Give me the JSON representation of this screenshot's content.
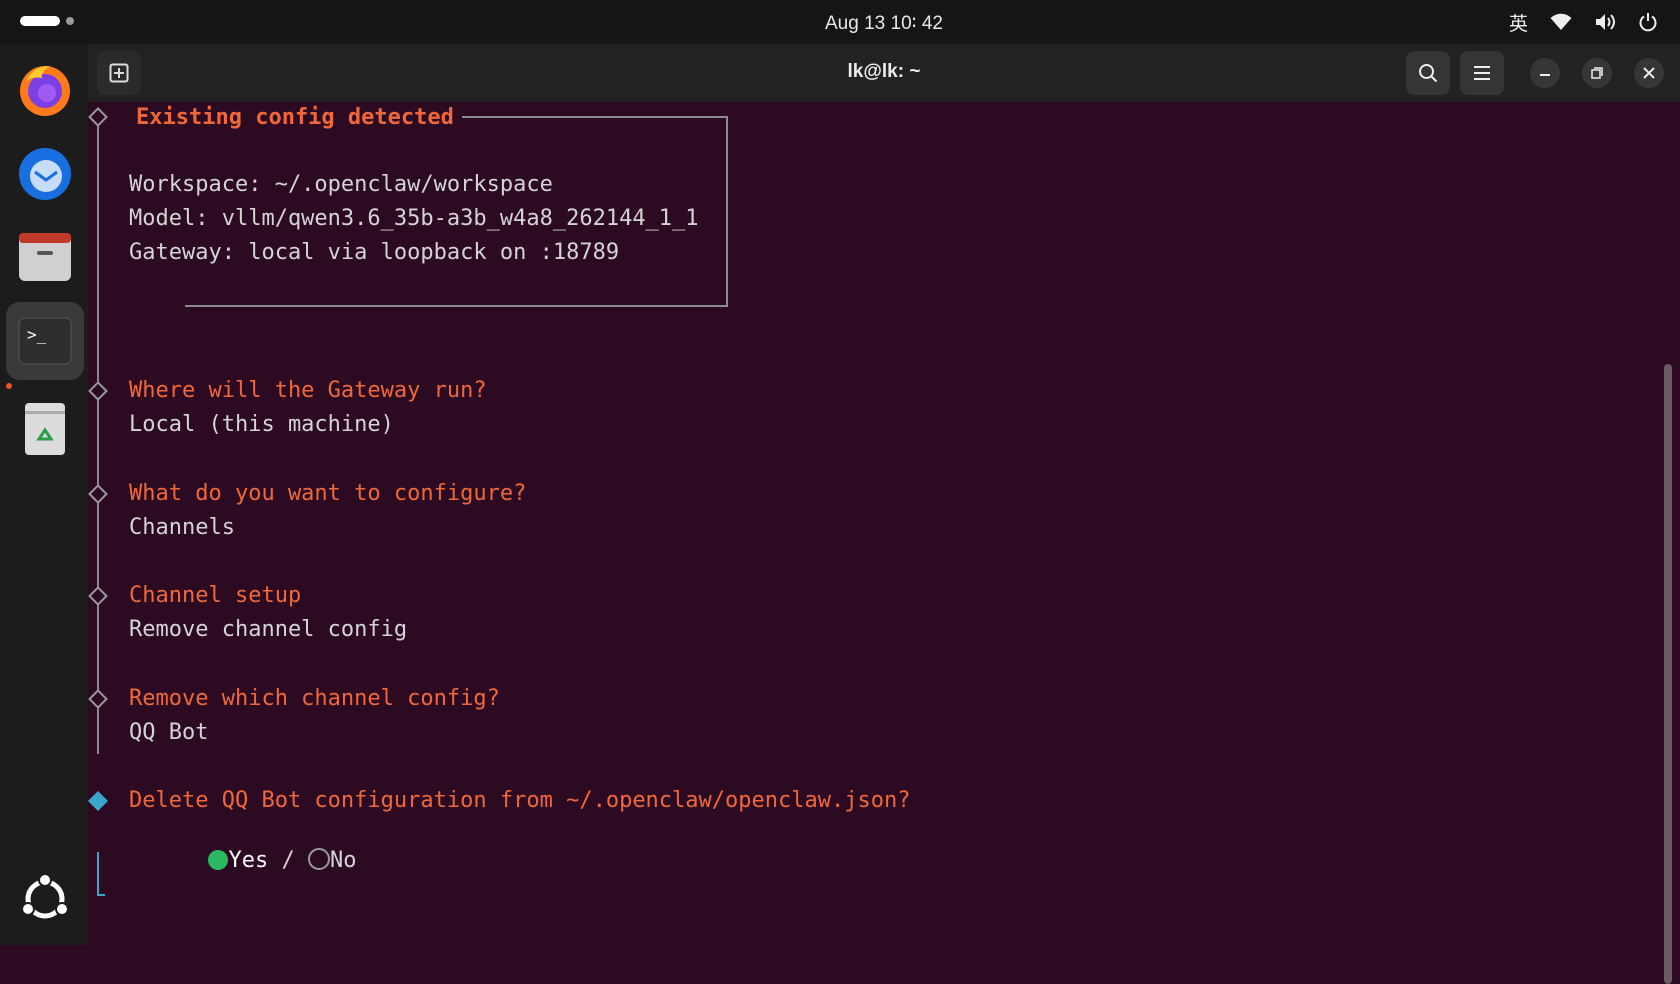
{
  "topbar": {
    "clock": "Aug 13  10∶ 42",
    "ime": "英"
  },
  "dock": {
    "items": [
      {
        "name": "firefox-icon"
      },
      {
        "name": "thunderbird-icon"
      },
      {
        "name": "files-icon"
      },
      {
        "name": "terminal-icon"
      },
      {
        "name": "trash-icon"
      },
      {
        "name": "ubuntu-show-apps-icon"
      }
    ]
  },
  "window": {
    "title": "lk@lk: ~"
  },
  "terminal": {
    "config_box": {
      "title": "Existing config detected",
      "workspace": "Workspace: ~/.openclaw/workspace",
      "model": "Model: vllm/qwen3.6_35b-a3b_w4a8_262144_1_1",
      "gateway": "Gateway: local via loopback on :18789"
    },
    "steps": [
      {
        "question": "Where will the Gateway run?",
        "answer": "Local (this machine)"
      },
      {
        "question": "What do you want to configure?",
        "answer": "Channels"
      },
      {
        "question": "Channel setup",
        "answer": "Remove channel config"
      },
      {
        "question": "Remove which channel config?",
        "answer": "QQ Bot"
      }
    ],
    "confirm": {
      "question": "Delete QQ Bot configuration from ~/.openclaw/openclaw.json?",
      "yes": "Yes",
      "separator": "/",
      "no": "No",
      "selected": "Yes"
    }
  },
  "colors": {
    "terminal_bg": "#2c0a22",
    "prompt_orange": "#f0683a",
    "active_cyan": "#3aa6c9",
    "radio_green": "#2ab860"
  }
}
